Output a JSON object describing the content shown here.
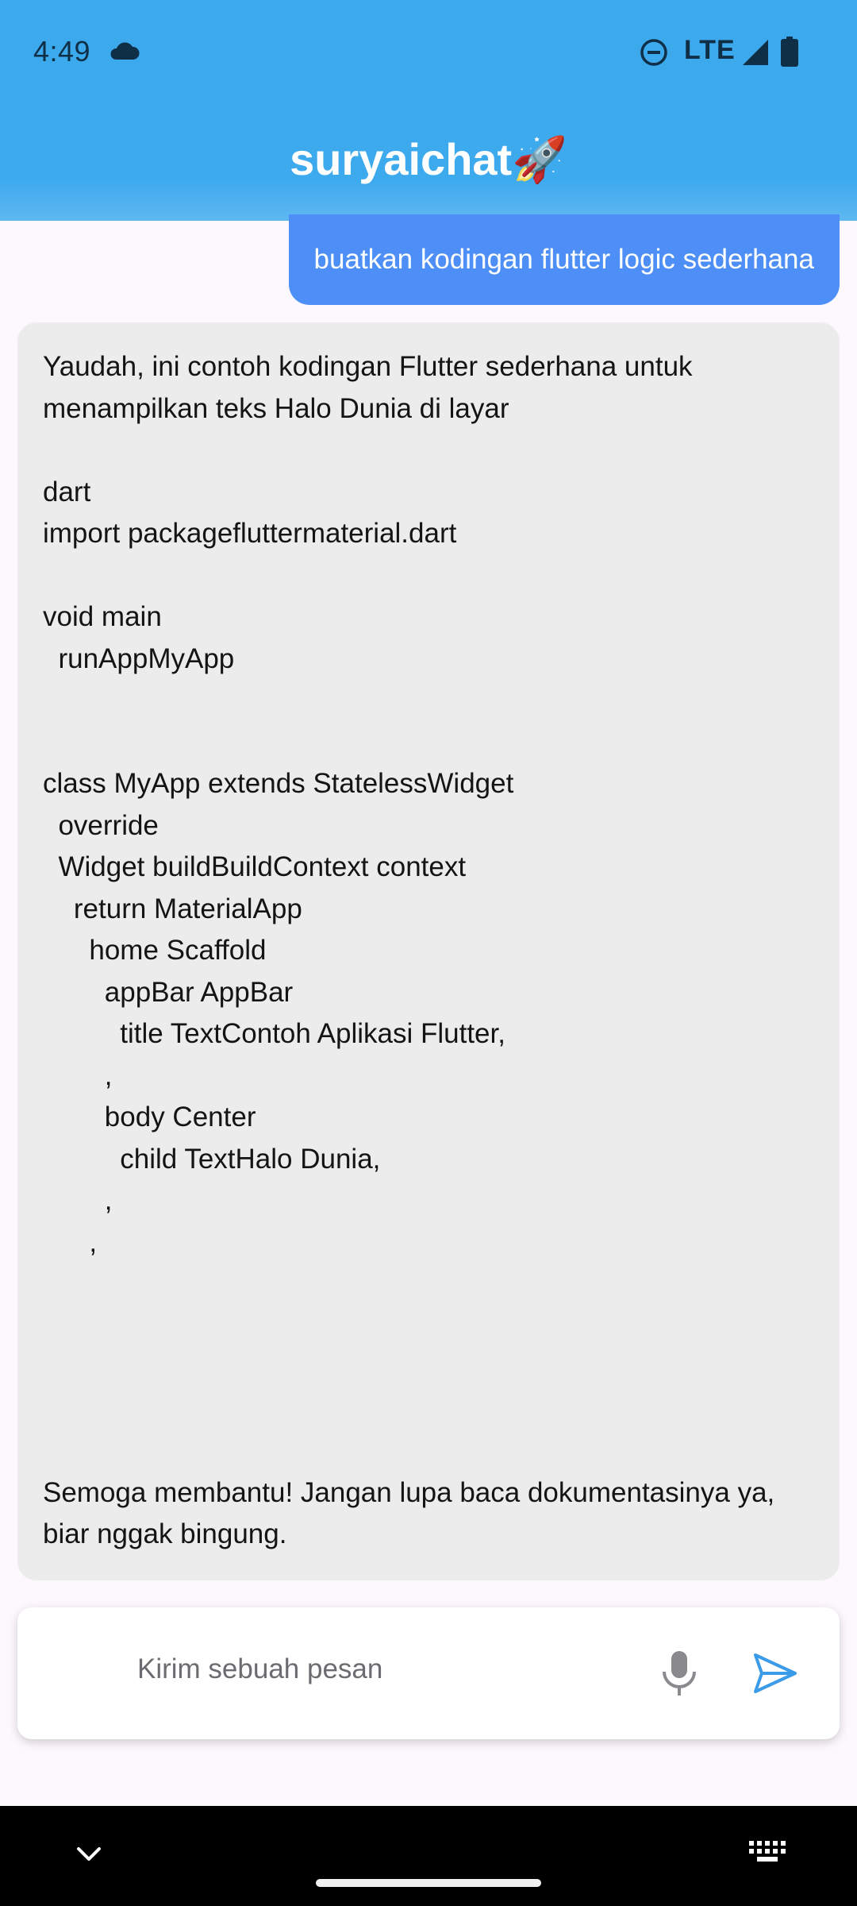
{
  "status_bar": {
    "time": "4:49",
    "network": "LTE",
    "icons": [
      "cloud-icon",
      "do-not-disturb-icon",
      "signal-icon",
      "battery-icon"
    ]
  },
  "app": {
    "title": "suryaichat🚀",
    "colors": {
      "header": "#3ba9ec",
      "user_bubble": "#4d8ff6",
      "bot_bubble": "#ececec",
      "send_icon": "#3c9be8"
    }
  },
  "messages": [
    {
      "role": "user",
      "text": "buatkan kodingan flutter logic sederhana"
    },
    {
      "role": "assistant",
      "text": "Yaudah, ini contoh kodingan Flutter sederhana untuk menampilkan teks Halo Dunia di layar\n\ndart\nimport packagefluttermaterial.dart\n\nvoid main\n  runAppMyApp\n\n\nclass MyApp extends StatelessWidget\n  override\n  Widget buildBuildContext context\n    return MaterialApp\n      home Scaffold\n        appBar AppBar\n          title TextContoh Aplikasi Flutter,\n        ,\n        body Center\n          child TextHalo Dunia,\n        ,\n      ,\n\n\n\n\n\nSemoga membantu! Jangan lupa baca dokumentasinya ya, biar nggak bingung."
    }
  ],
  "composer": {
    "placeholder": "Kirim sebuah pesan",
    "icons": [
      "mic-icon",
      "send-icon"
    ]
  },
  "nav_bar": {
    "icons": [
      "chevron-down-icon",
      "keyboard-icon"
    ]
  }
}
